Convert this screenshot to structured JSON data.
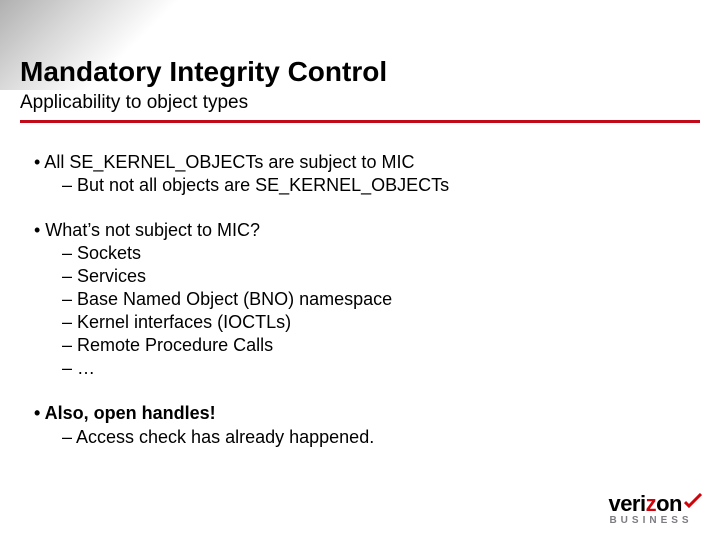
{
  "header": {
    "title": "Mandatory Integrity Control",
    "subtitle": "Applicability to object types"
  },
  "body": {
    "b1_l1": "• All SE_KERNEL_OBJECTs are subject to MIC",
    "b1_l2": "– But not all objects are SE_KERNEL_OBJECTs",
    "b2_l1": "• What’s not subject to MIC?",
    "b2_sockets": "– Sockets",
    "b2_services": "– Services",
    "b2_bno": "– Base Named Object (BNO) namespace",
    "b2_ioctls": "– Kernel interfaces (IOCTLs)",
    "b2_rpc": "– Remote Procedure Calls",
    "b2_more": "– …",
    "b3_l1": "• Also, open handles!",
    "b3_l2": "– Access check has already happened."
  },
  "logo": {
    "part_veri": "veri",
    "part_z": "z",
    "part_on": "on",
    "sub": "BUSINESS"
  },
  "colors": {
    "rule": "#c20b1a",
    "logo_red": "#cd040b",
    "logo_sub": "#7c7c82"
  }
}
